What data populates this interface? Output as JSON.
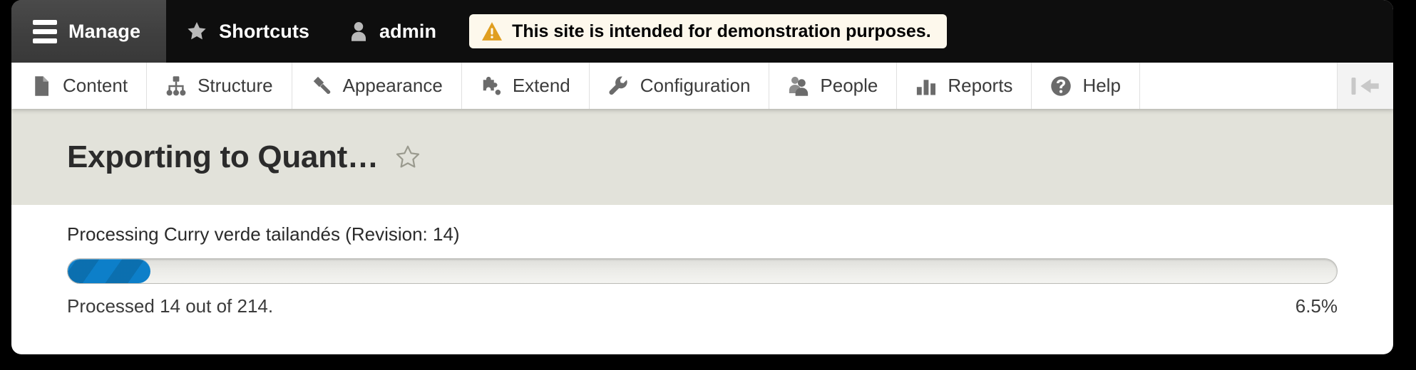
{
  "toolbar": {
    "manage_label": "Manage",
    "shortcuts_label": "Shortcuts",
    "account_label": "admin",
    "demo_notice": "This site is intended for demonstration purposes."
  },
  "admin_menu": {
    "items": [
      {
        "label": "Content",
        "icon": "file-icon"
      },
      {
        "label": "Structure",
        "icon": "sitemap-icon"
      },
      {
        "label": "Appearance",
        "icon": "paintbrush-icon"
      },
      {
        "label": "Extend",
        "icon": "puzzle-icon"
      },
      {
        "label": "Configuration",
        "icon": "wrench-icon"
      },
      {
        "label": "People",
        "icon": "people-icon"
      },
      {
        "label": "Reports",
        "icon": "bar-chart-icon"
      },
      {
        "label": "Help",
        "icon": "question-circle-icon"
      }
    ],
    "collapse_icon": "collapse-sidebar-icon"
  },
  "page": {
    "title": "Exporting to Quant…",
    "favorite_icon": "star-outline-icon"
  },
  "progress": {
    "label": "Processing Curry verde tailandés (Revision: 14)",
    "message": "Processed 14 out of 214.",
    "percent_label": "6.5%",
    "percent_value": 6.5,
    "processed": 14,
    "total": 214
  },
  "colors": {
    "toolbar_bg": "#0e0e0e",
    "manage_tab_bg": "#3f3f3f",
    "notice_bg": "#fdf8ec",
    "notice_icon": "#e09e20",
    "header_band_bg": "#e2e2da",
    "progress_fill": "#0d7fc9",
    "text": "#3b3b3b"
  }
}
